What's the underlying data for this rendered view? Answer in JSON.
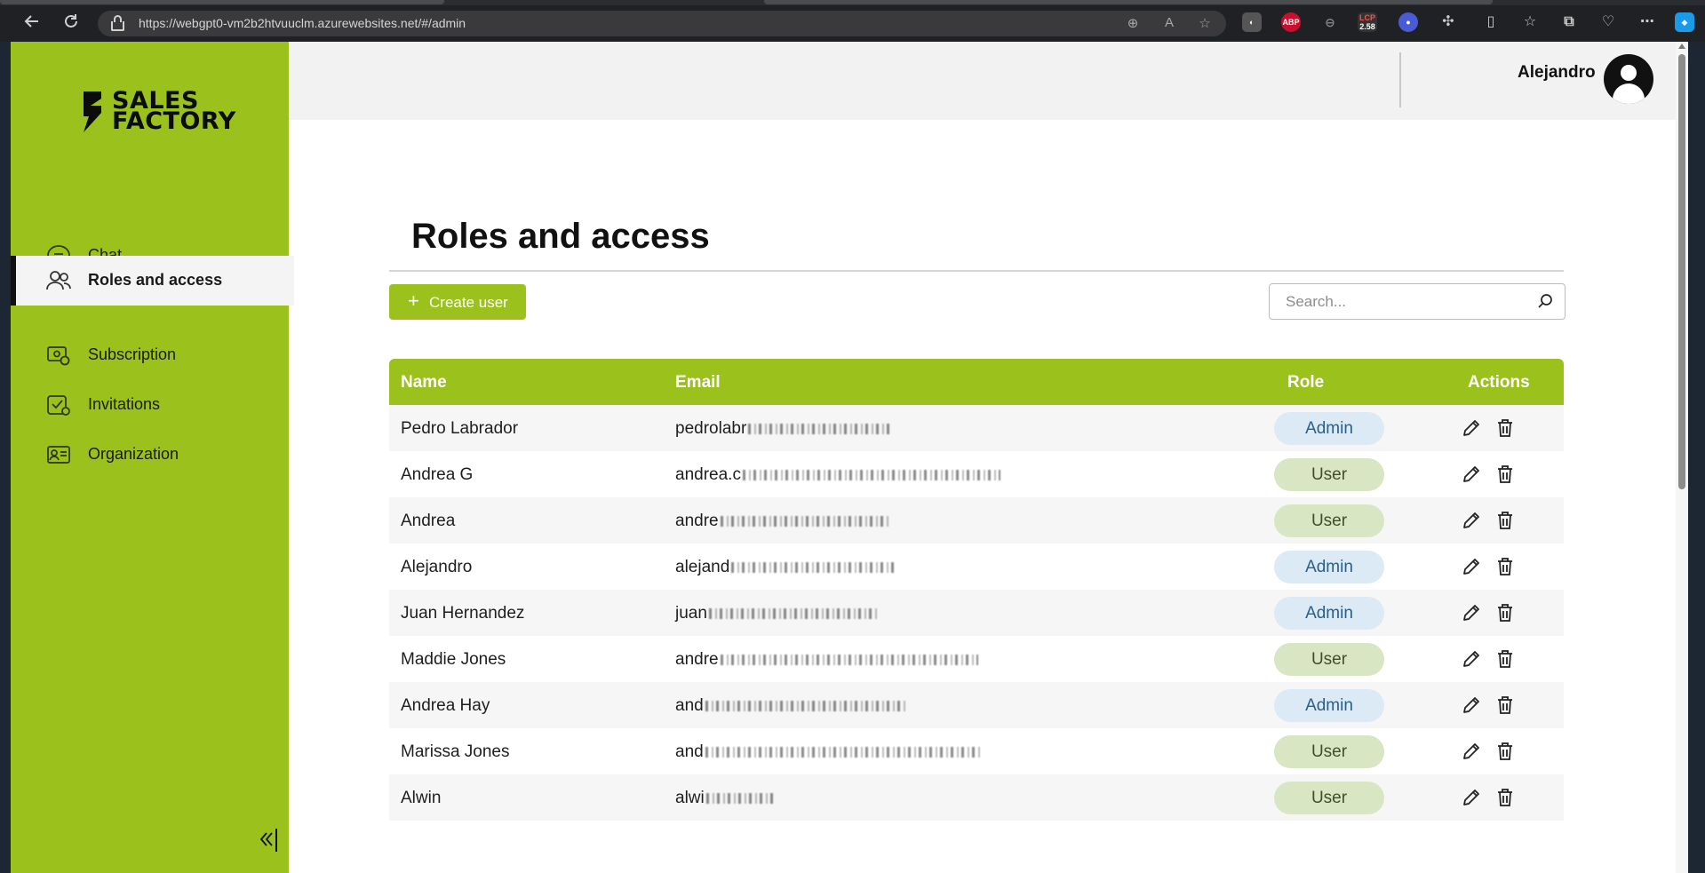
{
  "browser": {
    "url": "https://webgpt0-vm2b2htvuuclm.azurewebsites.net/#/admin",
    "lcp_value": "2.58"
  },
  "brand": {
    "line1": "SALES",
    "line2": "FACTORY",
    "accent": "#9bc11d"
  },
  "sidebar": {
    "items": [
      {
        "label": "Chat",
        "icon": "chat-bubble-icon",
        "active": false
      },
      {
        "label": "Roles and access",
        "icon": "users-icon",
        "active": true
      },
      {
        "label": "Subscription",
        "icon": "subscription-icon",
        "active": false
      },
      {
        "label": "Invitations",
        "icon": "invitations-icon",
        "active": false
      },
      {
        "label": "Organization",
        "icon": "organization-icon",
        "active": false
      }
    ],
    "collapse_label": "«|"
  },
  "header": {
    "user_name": "Alejandro"
  },
  "main": {
    "title": "Roles and access",
    "create_button": "Create user",
    "search_placeholder": "Search..."
  },
  "table": {
    "columns": [
      "Name",
      "Email",
      "Role",
      "Actions"
    ],
    "rows": [
      {
        "name": "Pedro Labrador",
        "email": "pedrolabr",
        "role": "Admin"
      },
      {
        "name": "Andrea G",
        "email": "andrea.c",
        "role": "User"
      },
      {
        "name": "Andrea",
        "email": "andre",
        "role": "User"
      },
      {
        "name": "Alejandro",
        "email": "alejand",
        "role": "Admin"
      },
      {
        "name": "Juan Hernandez",
        "email": "juan",
        "role": "Admin"
      },
      {
        "name": "Maddie Jones",
        "email": "andre",
        "role": "User"
      },
      {
        "name": "Andrea Hay",
        "email": "and",
        "role": "Admin"
      },
      {
        "name": "Marissa Jones",
        "email": "and",
        "role": "User"
      },
      {
        "name": "Alwin",
        "email": "alwi",
        "role": "User"
      }
    ]
  }
}
